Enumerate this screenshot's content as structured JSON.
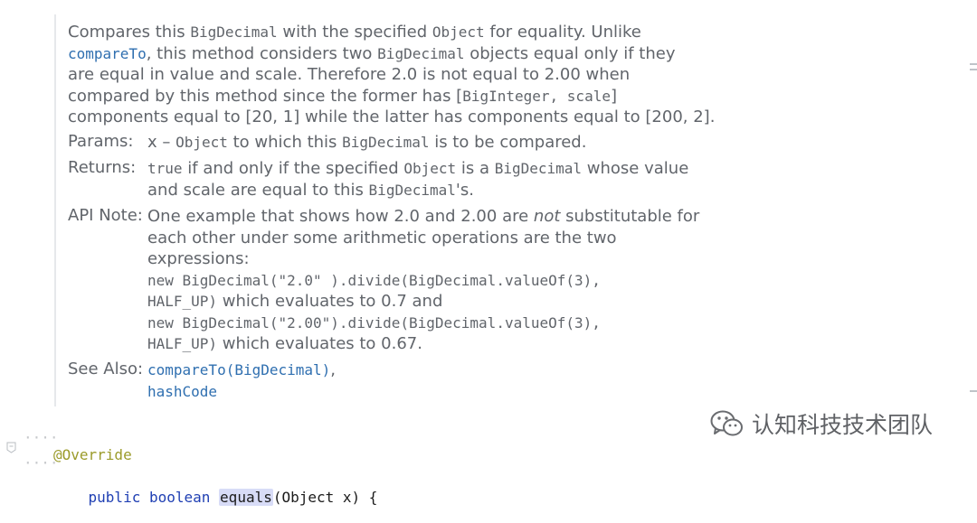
{
  "doc": {
    "lines": [
      [
        "Compares this ",
        {
          "mono": "BigDecimal"
        },
        " with the specified ",
        {
          "mono": "Object"
        },
        " for equality. Unlike"
      ],
      [
        {
          "link": "compareTo"
        },
        ", this method considers two ",
        {
          "mono": "BigDecimal"
        },
        " objects equal only if they"
      ],
      [
        "are equal in value and scale. Therefore 2.0 is not equal to 2.00 when"
      ],
      [
        "compared by this method since the former has [",
        {
          "mono": "BigInteger, scale"
        },
        "]"
      ],
      [
        "components equal to [20, 1] while the latter has components equal to [200, 2]."
      ]
    ],
    "params_label": "Params:",
    "params": [
      [
        "x – ",
        {
          "mono": "Object"
        },
        " to which this ",
        {
          "mono": "BigDecimal"
        },
        " is to be compared."
      ]
    ],
    "returns_label": "Returns:",
    "returns": [
      [
        {
          "mono": "true"
        },
        " if and only if the specified ",
        {
          "mono": "Object"
        },
        " is a ",
        {
          "mono": "BigDecimal"
        },
        " whose value"
      ],
      [
        "and scale are equal to this ",
        {
          "mono": "BigDecimal"
        },
        "'s."
      ]
    ],
    "api_label": "API Note:",
    "api": [
      [
        "One example that shows how 2.0 and 2.00 are ",
        {
          "em": "not"
        },
        " substitutable for"
      ],
      [
        "each other under some arithmetic operations are the two"
      ],
      [
        "expressions:"
      ],
      [
        {
          "mono": "new BigDecimal(\"2.0\" ).divide(BigDecimal.valueOf(3),"
        }
      ],
      [
        {
          "mono": "HALF_UP)"
        },
        " which evaluates to 0.7 and"
      ],
      [
        {
          "mono": "new BigDecimal(\"2.00\").divide(BigDecimal.valueOf(3),"
        }
      ],
      [
        {
          "mono": "HALF_UP)"
        },
        " which evaluates to 0.67."
      ]
    ],
    "see_label": "See Also:",
    "see": [
      [
        {
          "link": "compareTo(BigDecimal)"
        },
        ","
      ],
      [
        {
          "link": "hashCode"
        }
      ]
    ]
  },
  "code": {
    "indent_dots": "····",
    "annotation": "@Override",
    "kw_public": "public",
    "kw_boolean": "boolean",
    "method_name": "equals",
    "params": "(Object x) {"
  },
  "watermark": {
    "text": "认知科技技术团队",
    "icon": "wechat-icon"
  },
  "colors": {
    "link": "#2f6fb0",
    "annotation": "#9b9b2a",
    "keyword": "#1f3fb3",
    "highlight": "#d8dcf7"
  }
}
